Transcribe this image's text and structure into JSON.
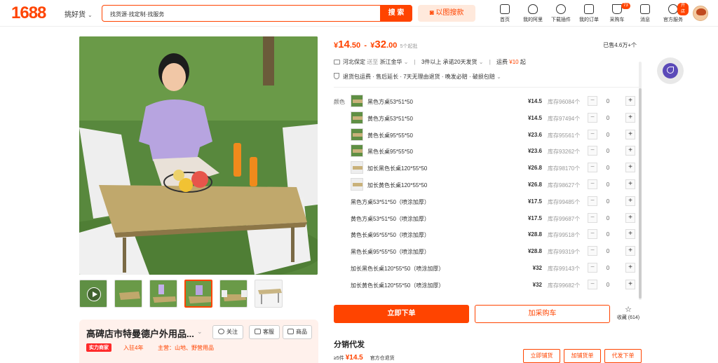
{
  "header": {
    "logo": "1688",
    "category": "挑好货",
    "search_placeholder": "找货源·找定制·找服务",
    "search_button": "搜 索",
    "image_search": "以图搜款",
    "nav": [
      {
        "label": "首页",
        "icon": "home-icon"
      },
      {
        "label": "我的阿里",
        "icon": "heart-shield-icon"
      },
      {
        "label": "下载插件",
        "icon": "puzzle-icon"
      },
      {
        "label": "我的订单",
        "icon": "order-list-icon"
      },
      {
        "label": "采购车",
        "icon": "cart-icon",
        "badge": "73"
      },
      {
        "label": "消息",
        "icon": "message-icon"
      },
      {
        "label": "官方服务",
        "icon": "user-service-icon",
        "badge": "开店"
      }
    ]
  },
  "shop": {
    "name": "高碑店市特曼德户外用品...",
    "follow": "关注",
    "service": "客服",
    "goods": "商品",
    "tag": "实力商家",
    "tenure": "入驻4年",
    "main": "主营：山地、野营用品"
  },
  "product": {
    "price_low_int": "14",
    "price_low_dec": ".50",
    "price_high_int": "32",
    "price_high_dec": ".00",
    "currency": "¥",
    "sep": "-",
    "min_order": "5个起批",
    "sold": "已售4.6万+个",
    "ship_from": "河北保定",
    "ship_to_label": "送至",
    "ship_to": "浙江金华",
    "ship_promise": "3件以上  承诺20天发货",
    "freight_label": "运费",
    "freight": "¥10",
    "freight_suffix": "起",
    "services": "退货包运费 · 售后延长 · 7天无理由退货 · 晚发必赔 · 破损包赔"
  },
  "sku": {
    "color_label": "颜色",
    "rows": [
      {
        "name": "黑色方桌53*51*50",
        "price": "¥14.5",
        "stock": "库存96084个",
        "qty": "0",
        "img": true
      },
      {
        "name": "黄色方桌53*51*50",
        "price": "¥14.5",
        "stock": "库存97494个",
        "qty": "0",
        "img": true
      },
      {
        "name": "黄色长桌95*55*50",
        "price": "¥23.6",
        "stock": "库存95561个",
        "qty": "0",
        "img": true
      },
      {
        "name": "黑色长桌95*55*50",
        "price": "¥23.6",
        "stock": "库存93262个",
        "qty": "0",
        "img": true
      },
      {
        "name": "加长黑色长桌120*55*50",
        "price": "¥26.8",
        "stock": "库存98170个",
        "qty": "0",
        "img": true
      },
      {
        "name": "加长黄色长桌120*55*50",
        "price": "¥26.8",
        "stock": "库存98627个",
        "qty": "0",
        "img": true
      },
      {
        "name": "黑色方桌53*51*50（喷涂加厚）",
        "price": "¥17.5",
        "stock": "库存99485个",
        "qty": "0",
        "img": false
      },
      {
        "name": "黄色方桌53*51*50（喷涂加厚）",
        "price": "¥17.5",
        "stock": "库存99687个",
        "qty": "0",
        "img": false
      },
      {
        "name": "黄色长桌95*55*50（喷涂加厚）",
        "price": "¥28.8",
        "stock": "库存99518个",
        "qty": "0",
        "img": false
      },
      {
        "name": "黑色长桌95*55*50（喷涂加厚）",
        "price": "¥28.8",
        "stock": "库存99319个",
        "qty": "0",
        "img": false
      },
      {
        "name": "加长黑色长桌120*55*50（喷涂加厚）",
        "price": "¥32",
        "stock": "库存99143个",
        "qty": "0",
        "img": false
      },
      {
        "name": "加长黄色长桌120*55*50（喷涂加厚）",
        "price": "¥32",
        "stock": "库存99682个",
        "qty": "0",
        "img": false
      }
    ]
  },
  "actions": {
    "order": "立即下单",
    "cart": "加采购车",
    "fav": "收藏 (614)"
  },
  "distribution": {
    "title": "分销代发",
    "qty": "≥5件",
    "price": "¥14.5",
    "note": "官方仓退货",
    "buttons": [
      "立即铺货",
      "加铺货单",
      "代发下单"
    ]
  },
  "colors": {
    "brand": "#ff4400"
  }
}
